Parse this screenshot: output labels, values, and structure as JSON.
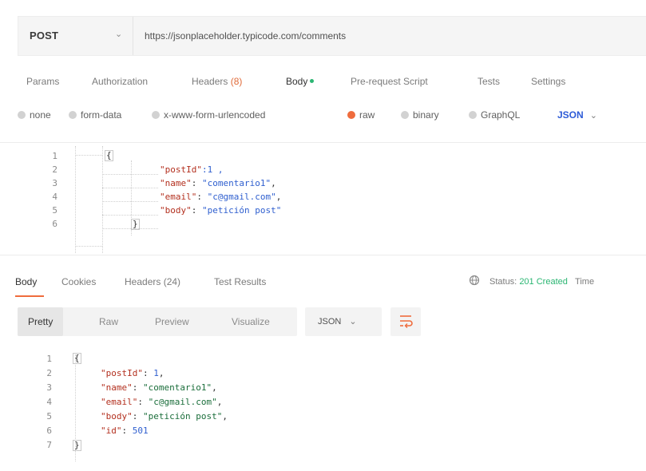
{
  "request": {
    "method": "POST",
    "url": "https://jsonplaceholder.typicode.com/comments"
  },
  "request_tabs": {
    "params": "Params",
    "authorization": "Authorization",
    "headers": "Headers",
    "headers_count": "(8)",
    "body": "Body",
    "pre_request": "Pre-request Script",
    "tests": "Tests",
    "settings": "Settings"
  },
  "body_types": {
    "none": "none",
    "form_data": "form-data",
    "urlencoded": "x-www-form-urlencoded",
    "raw": "raw",
    "binary": "binary",
    "graphql": "GraphQL",
    "format": "JSON",
    "selected": "raw"
  },
  "request_body": {
    "line_numbers": [
      "1",
      "2",
      "3",
      "4",
      "5",
      "6"
    ],
    "open": "{",
    "close": "}",
    "l2_key": "\"postId\"",
    "l2_val": ":1 ,",
    "l3_key": "\"name\"",
    "l3_sep": ": ",
    "l3_val": "\"comentario1\"",
    "l3_end": ",",
    "l4_key": "\"email\"",
    "l4_sep": ": ",
    "l4_val": "\"c@gmail.com\"",
    "l4_end": ",",
    "l5_key": "\"body\"",
    "l5_sep": ": ",
    "l5_val": "\"petición post\""
  },
  "response_tabs": {
    "body": "Body",
    "cookies": "Cookies",
    "headers": "Headers (24)",
    "test_results": "Test Results"
  },
  "status": {
    "label": "Status:",
    "value": "201 Created",
    "time_label": "Time"
  },
  "view_modes": {
    "pretty": "Pretty",
    "raw": "Raw",
    "preview": "Preview",
    "visualize": "Visualize",
    "format": "JSON"
  },
  "response_body": {
    "line_numbers": [
      "1",
      "2",
      "3",
      "4",
      "5",
      "6",
      "7"
    ],
    "open": "{",
    "close": "}",
    "l2_key": "\"postId\"",
    "l2_sep": ": ",
    "l2_val": "1",
    "l2_end": ",",
    "l3_key": "\"name\"",
    "l3_sep": ": ",
    "l3_val": "\"comentario1\"",
    "l3_end": ",",
    "l4_key": "\"email\"",
    "l4_sep": ": ",
    "l4_val": "\"c@gmail.com\"",
    "l4_end": ",",
    "l5_key": "\"body\"",
    "l5_sep": ": ",
    "l5_val": "\"petición post\"",
    "l5_end": ",",
    "l6_key": "\"id\"",
    "l6_sep": ": ",
    "l6_val": "501"
  },
  "colors": {
    "accent": "#ef6c3d",
    "status_ok": "#2bb673",
    "json_blue": "#2d5bd7"
  },
  "icons": [
    "chevron-down-icon",
    "globe-icon",
    "wrap-lines-icon"
  ]
}
